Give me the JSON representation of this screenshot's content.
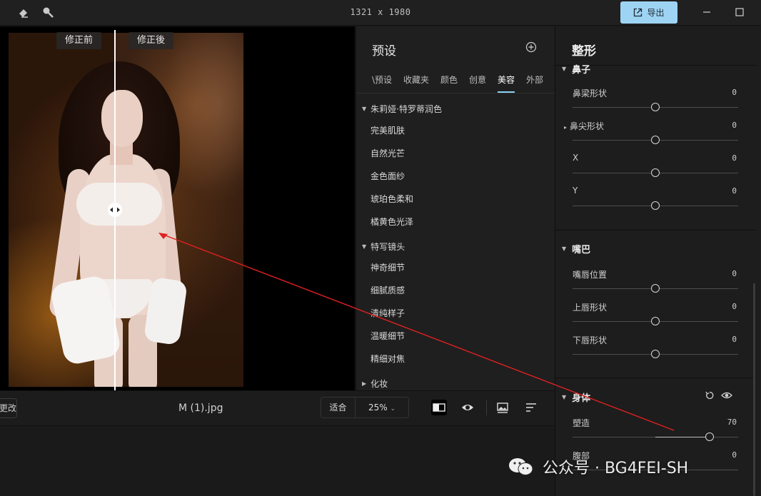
{
  "toolbar": {
    "dimensions": "1321 x 1980",
    "export_label": "导出"
  },
  "canvas": {
    "before_label": "修正前",
    "after_label": "修正後"
  },
  "bottom": {
    "change_label": "更改",
    "filename": "M (1).jpg",
    "fit_label": "适合",
    "zoom": "25%"
  },
  "presets": {
    "title": "预设",
    "tabs": [
      "\\预设",
      "收藏夹",
      "颜色",
      "创意",
      "美容",
      "外部"
    ],
    "active_tab": "美容",
    "groups": [
      {
        "name": "朱莉娅·特罗蒂润色",
        "items": [
          "完美肌肤",
          "自然光芒",
          "金色面纱",
          "琥珀色柔和",
          "橘黄色光泽"
        ]
      },
      {
        "name": "特写镜头",
        "items": [
          "神奇细节",
          "细腻质感",
          "清纯样子",
          "温暖细节",
          "精细对焦"
        ]
      },
      {
        "name": "化妆",
        "items": []
      }
    ]
  },
  "reshape": {
    "title": "整形",
    "nose_section": "鼻子",
    "nose_params": [
      {
        "label": "鼻梁形状",
        "value": "0",
        "level": 0.5
      },
      {
        "label": "鼻尖形状",
        "value": "0",
        "level": 0.5
      },
      {
        "label": "X",
        "value": "0",
        "level": 0.5
      },
      {
        "label": "Y",
        "value": "0",
        "level": 0.5
      }
    ],
    "mouth_section": "嘴巴",
    "mouth_params": [
      {
        "label": "嘴唇位置",
        "value": "0",
        "level": 0.5
      },
      {
        "label": "上唇形状",
        "value": "0",
        "level": 0.5
      },
      {
        "label": "下唇形状",
        "value": "0",
        "level": 0.5
      }
    ],
    "body_section": "身体",
    "body_params": [
      {
        "label": "塑造",
        "value": "70",
        "level": 0.85
      },
      {
        "label": "腹部",
        "value": "0",
        "level": 0.5
      }
    ]
  },
  "watermark": {
    "text": "公众号 · BG4FEI-SH"
  },
  "colors": {
    "accent": "#9ed4f3",
    "annotation": "#e02020"
  }
}
